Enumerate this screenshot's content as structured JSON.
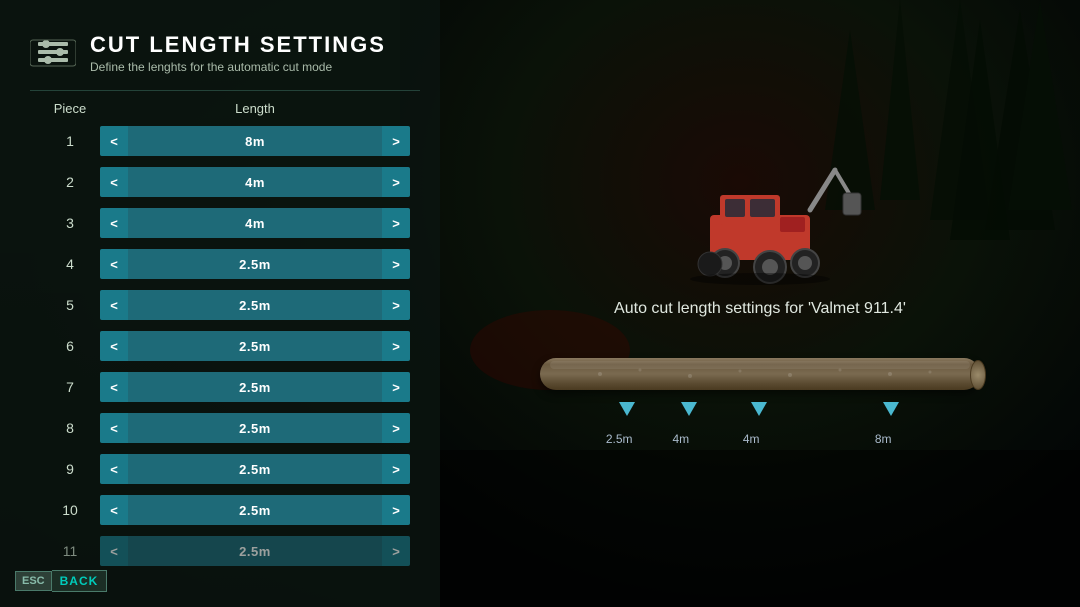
{
  "header": {
    "title": "CUT LENGTH SETTINGS",
    "subtitle": "Define the lenghts for the automatic cut mode",
    "icon": "gear-settings"
  },
  "columns": {
    "piece": "Piece",
    "length": "Length"
  },
  "rows": [
    {
      "id": 1,
      "value": "8m"
    },
    {
      "id": 2,
      "value": "4m"
    },
    {
      "id": 3,
      "value": "4m"
    },
    {
      "id": 4,
      "value": "2.5m"
    },
    {
      "id": 5,
      "value": "2.5m"
    },
    {
      "id": 6,
      "value": "2.5m"
    },
    {
      "id": 7,
      "value": "2.5m"
    },
    {
      "id": 8,
      "value": "2.5m"
    },
    {
      "id": 9,
      "value": "2.5m"
    },
    {
      "id": 10,
      "value": "2.5m"
    },
    {
      "id": 11,
      "value": "2.5m"
    }
  ],
  "right_panel": {
    "auto_cut_label": "Auto cut length settings for 'Valmet 911.4'",
    "log_markers": [
      {
        "label": "2.5m",
        "position": 18
      },
      {
        "label": "4m",
        "position": 32
      },
      {
        "label": "4m",
        "position": 48
      },
      {
        "label": "8m",
        "position": 78
      }
    ]
  },
  "back_button": {
    "esc_label": "ESC",
    "back_label": "BACK"
  },
  "colors": {
    "accent": "#1a7a8a",
    "accent_light": "#4ab8d0",
    "text_primary": "#ffffff",
    "text_secondary": "#aabbcc"
  }
}
